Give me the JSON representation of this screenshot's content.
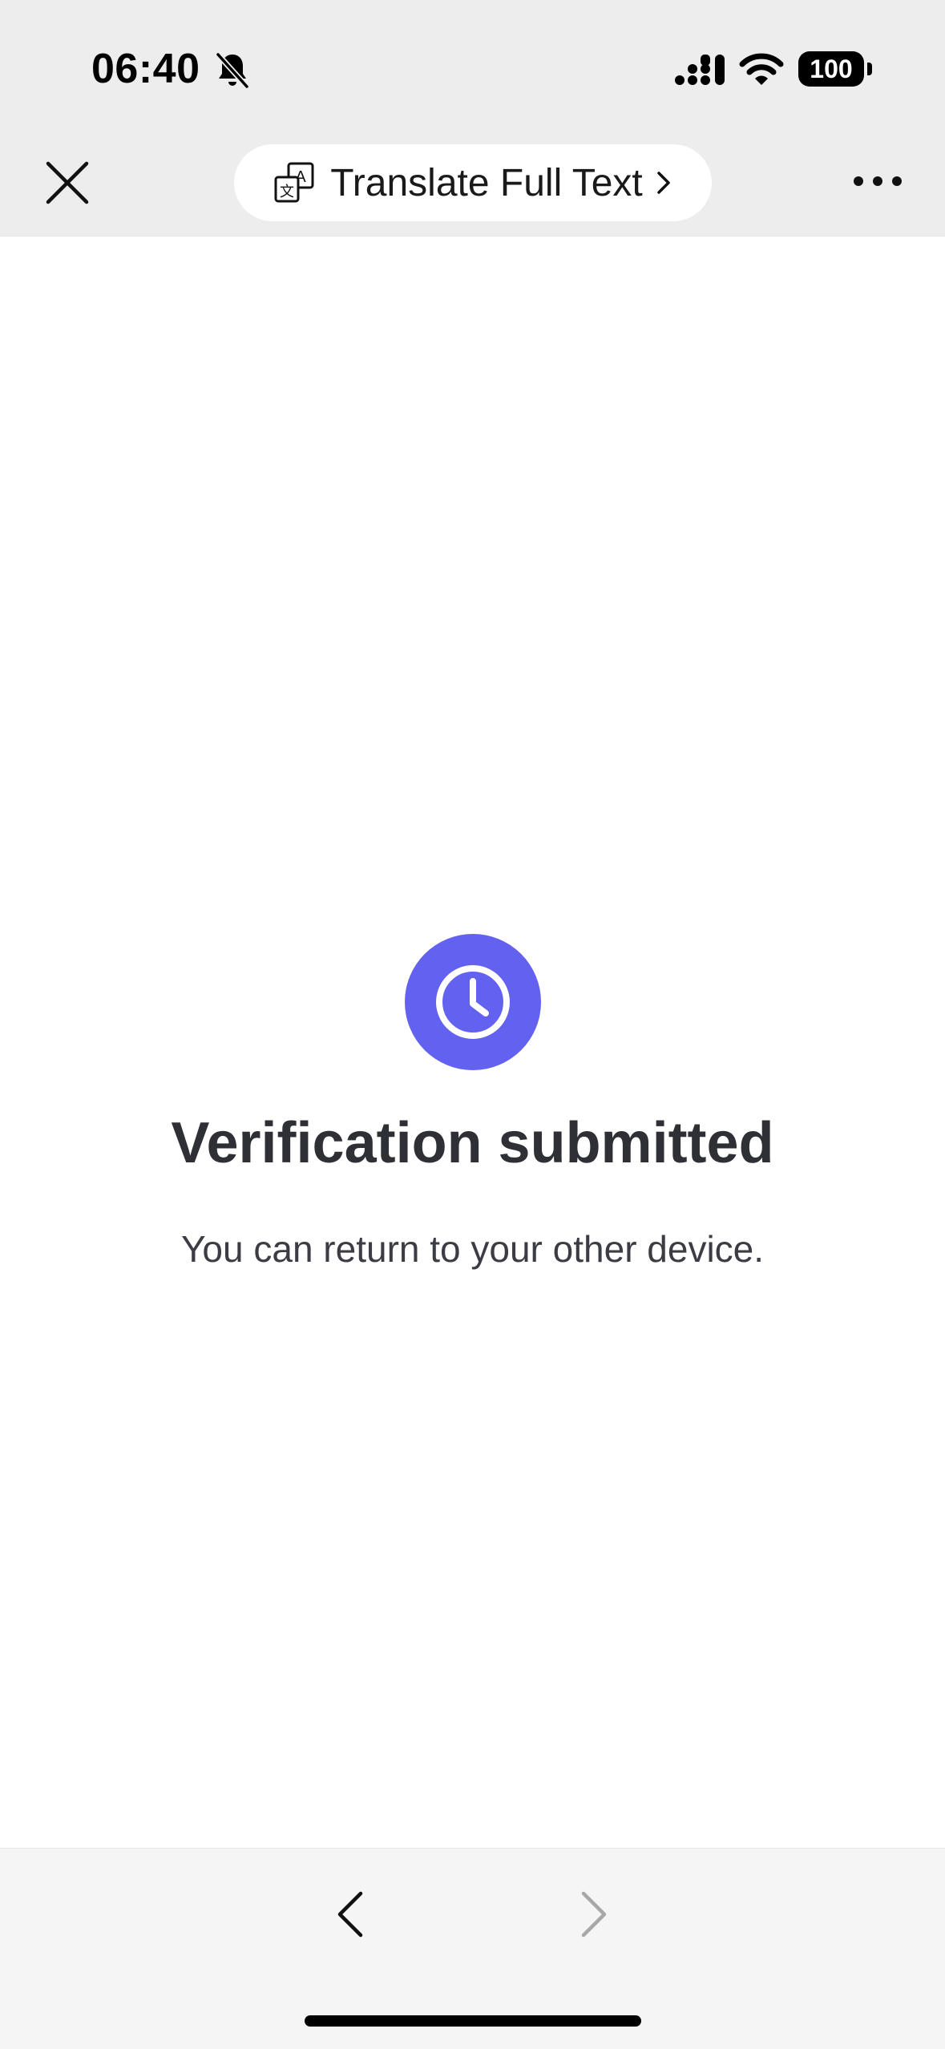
{
  "status_bar": {
    "time": "06:40",
    "battery": "100",
    "icons": [
      "bell-off-icon",
      "signal-icon",
      "wifi-icon",
      "battery-icon"
    ]
  },
  "nav": {
    "close_icon": "close-icon",
    "translate_label": "Translate Full Text",
    "translate_icon": "translate-icon",
    "more_icon": "more-icon"
  },
  "main": {
    "status_icon": "clock-icon",
    "title": "Verification submitted",
    "message": "You can return to your other device."
  },
  "toolbar": {
    "back_icon": "chevron-left-icon",
    "forward_icon": "chevron-right-icon"
  },
  "colors": {
    "accent": "#6361f0",
    "header_bg": "#ededed",
    "toolbar_bg": "#f5f5f5",
    "text": "#2f3036"
  }
}
